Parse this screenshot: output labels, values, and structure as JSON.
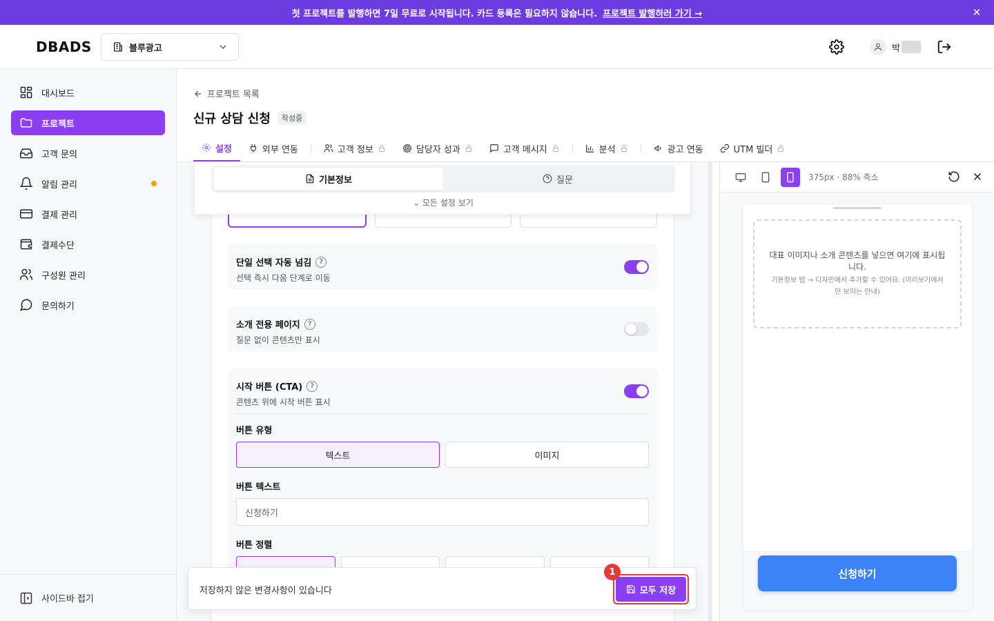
{
  "banner": {
    "text": "첫 프로젝트를 발행하면 7일 무료로 시작됩니다. 카드 등록은 필요하지 않습니다.",
    "link": "프로젝트 발행하러 가기 →"
  },
  "header": {
    "logo": "DBADS",
    "org": "블루광고",
    "user_name": "박"
  },
  "sidebar": {
    "items": [
      {
        "label": "대시보드",
        "icon": "dashboard-icon"
      },
      {
        "label": "프로젝트",
        "icon": "folder-icon"
      },
      {
        "label": "고객 문의",
        "icon": "inbox-icon"
      },
      {
        "label": "알림 관리",
        "icon": "bell-icon"
      },
      {
        "label": "결제 관리",
        "icon": "card-icon"
      },
      {
        "label": "결제수단",
        "icon": "wallet-icon"
      },
      {
        "label": "구성원 관리",
        "icon": "users-icon"
      },
      {
        "label": "문의하기",
        "icon": "chat-icon"
      }
    ],
    "collapse": "사이드바 접기"
  },
  "page": {
    "back": "프로젝트 목록",
    "title": "신규 상담 신청",
    "badge": "작성중"
  },
  "tabs": [
    {
      "label": "설정"
    },
    {
      "label": "외부 연동"
    },
    {
      "label": "고객 정보"
    },
    {
      "label": "담당자 성과"
    },
    {
      "label": "고객 메시지"
    },
    {
      "label": "분석"
    },
    {
      "label": "광고 연동"
    },
    {
      "label": "UTM 빌더"
    }
  ],
  "editor": {
    "seg_basic": "기본정보",
    "seg_question": "질문",
    "all_settings": "모든 설정 보기",
    "auto_next": {
      "title": "단일 선택 자동 넘김",
      "desc": "선택 즉시 다음 단계로 이동",
      "on": true
    },
    "intro_page": {
      "title": "소개 전용 페이지",
      "desc": "질문 없이 콘텐츠만 표시",
      "on": false
    },
    "cta": {
      "title": "시작 버튼 (CTA)",
      "desc": "콘텐츠 위에 시작 버튼 표시",
      "on": true,
      "type_label": "버튼 유형",
      "type_text": "텍스트",
      "type_image": "이미지",
      "text_label": "버튼 텍스트",
      "text_value": "신청하기",
      "align_label": "버튼 정렬"
    }
  },
  "save_bar": {
    "message": "저장하지 않은 변경사항이 있습니다",
    "save_label": "모두 저장",
    "marker": "1"
  },
  "preview": {
    "info": "375px · 88% 축소",
    "placeholder_main": "대표 이미지나 소개 콘텐츠를 넣으면 여기에 표시됩니다.",
    "placeholder_sub": "기본정보 탭 → 디자인에서 추가할 수 있어요. (미리보기에서만 보이는 안내)",
    "button": "신청하기"
  },
  "colors": {
    "primary": "#8b3ff0",
    "banner": "#6c3ce0",
    "preview_button": "#3b82f6",
    "highlight": "#e23b3b",
    "notify_dot": "#f59e0b"
  }
}
